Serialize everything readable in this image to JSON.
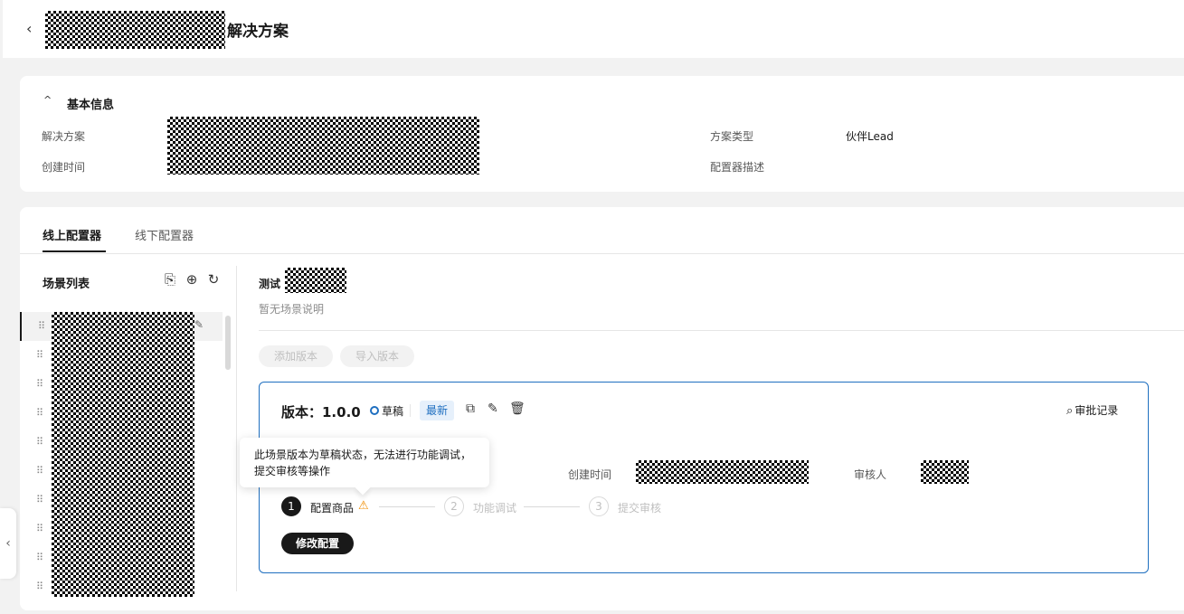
{
  "header": {
    "back_icon": "‹",
    "title": "解决方案"
  },
  "basic_info": {
    "collapse_icon": "^",
    "title": "基本信息",
    "solution_label": "解决方案",
    "created_label": "创建时间",
    "type_label": "方案类型",
    "type_value": "伙伴Lead",
    "desc_label": "配置器描述"
  },
  "tabs": [
    {
      "label": "线上配置器",
      "active": true
    },
    {
      "label": "线下配置器",
      "active": false
    }
  ],
  "scene_list": {
    "title": "场景列表",
    "icons": {
      "new": "⎘",
      "add": "⊕",
      "refresh": "↻"
    },
    "drag_glyph": "⠿"
  },
  "scene": {
    "name_prefix": "测试",
    "description": "暂无场景说明",
    "add_version_label": "添加版本",
    "import_version_label": "导入版本"
  },
  "version": {
    "title": "版本：1.0.0",
    "status": "草稿",
    "latest_badge": "最新",
    "audit_link": "审批记录",
    "created_label": "创建时间",
    "reviewer_label": "审核人",
    "steps": [
      {
        "num": "1",
        "label": "配置商品"
      },
      {
        "num": "2",
        "label": "功能调试"
      },
      {
        "num": "3",
        "label": "提交审核"
      }
    ],
    "modify_button": "修改配置"
  },
  "tooltip": {
    "text_line1": "此场景版本为草稿状态，无法进行功能调试，",
    "text_line2": "提交审核等操作"
  },
  "colors": {
    "accent": "#1f6fc0",
    "warn": "#f08c00",
    "dark": "#191919"
  }
}
